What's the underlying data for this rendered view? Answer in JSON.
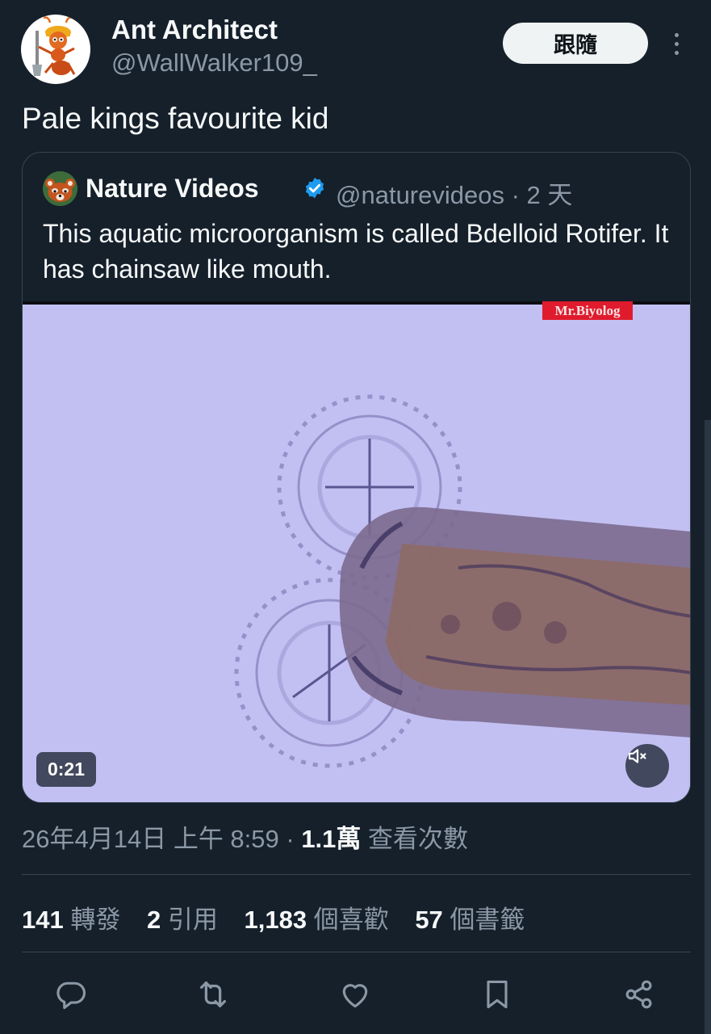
{
  "author": {
    "display_name": "Ant Architect",
    "handle": "@WallWalker109_",
    "avatar_icon": "ant-with-shovel-avatar"
  },
  "follow_button": "跟隨",
  "more_icon": "more-vertical-icon",
  "tweet_text": "Pale kings favourite kid",
  "quote": {
    "avatar_icon": "red-panda-avatar",
    "display_name": "Nature Videos",
    "verified_icon": "verified-badge-icon",
    "handle_time": "@naturevideos · 2 天",
    "text": "This aquatic microorganism is called Bdelloid Rotifer. It has chainsaw like mouth.",
    "media": {
      "watermark": "Mr.Biyolog",
      "duration": "0:21",
      "mute_icon": "volume-muted-icon"
    }
  },
  "meta": {
    "date": "26年4月14日 上午 8:59 · ",
    "views_count": "1.1萬",
    "views_label": " 查看次數"
  },
  "stats": [
    {
      "num": "141",
      "label": " 轉發"
    },
    {
      "num": "2",
      "label": " 引用"
    },
    {
      "num": "1,183",
      "label": " 個喜歡"
    },
    {
      "num": "57",
      "label": " 個書籤"
    }
  ],
  "actions": [
    "reply-icon",
    "retweet-icon",
    "like-icon",
    "bookmark-icon",
    "share-icon"
  ],
  "colors": {
    "background": "#15202b",
    "text": "#f7f9f9",
    "secondary": "#8b98a5",
    "border": "#38444d",
    "verified": "#1d9bf0"
  }
}
